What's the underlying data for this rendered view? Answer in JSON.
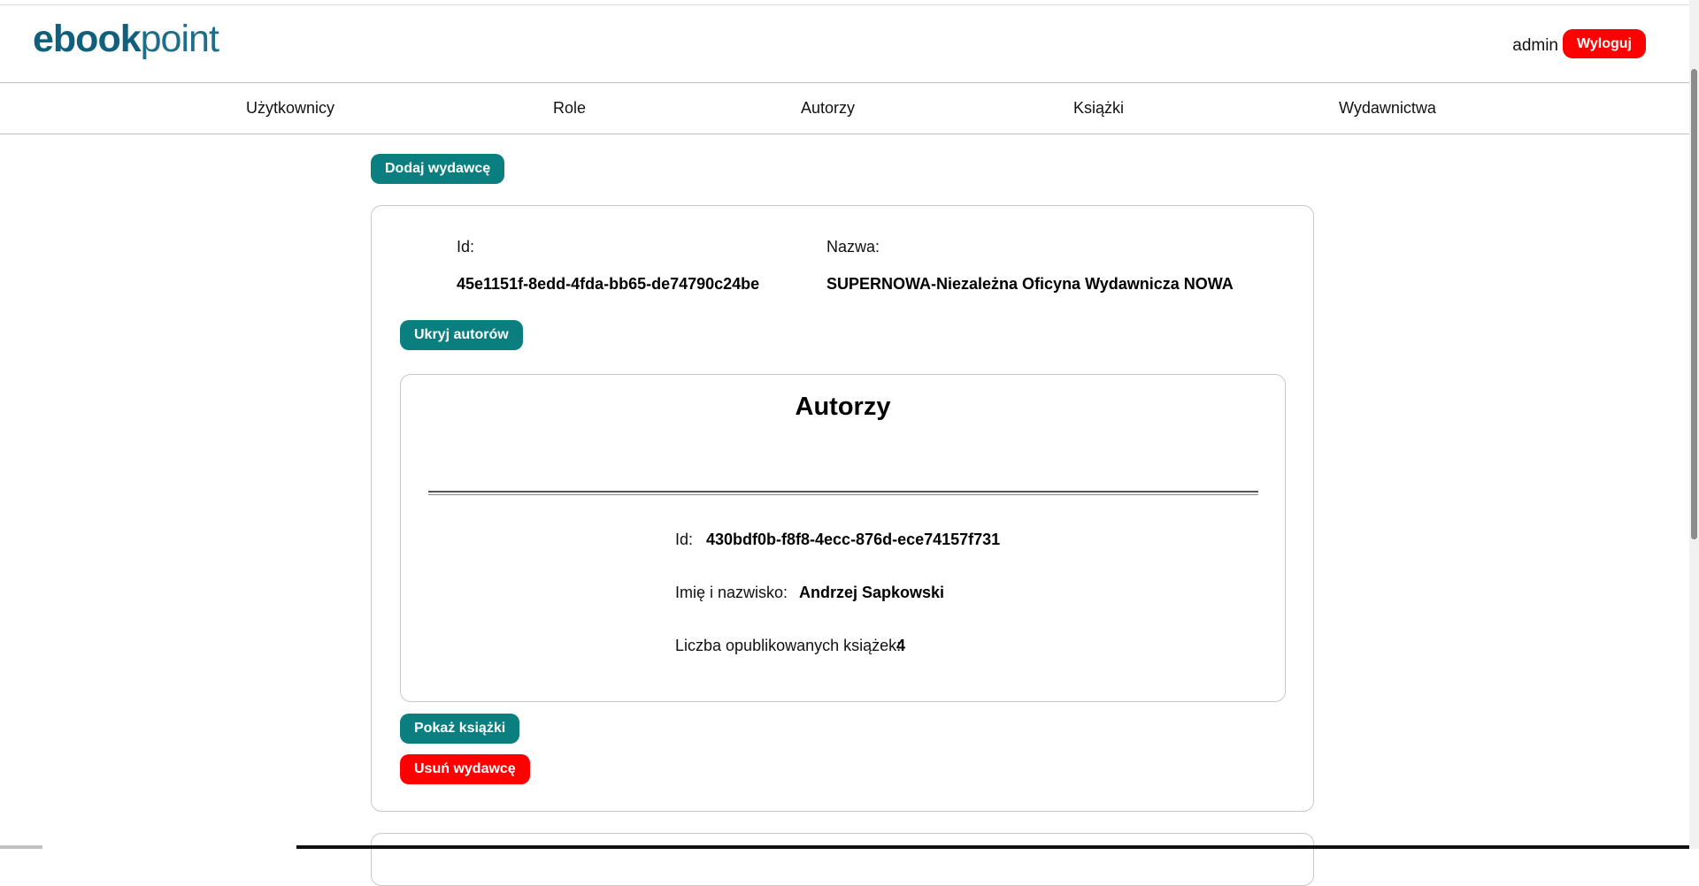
{
  "header": {
    "logo_prefix": "ebook",
    "logo_suffix": "point",
    "username": "admin",
    "logout_label": "Wyloguj"
  },
  "nav": {
    "items": [
      "Użytkownicy",
      "Role",
      "Autorzy",
      "Książki",
      "Wydawnictwa"
    ]
  },
  "toolbar": {
    "add_publisher_label": "Dodaj wydawcę"
  },
  "publisher": {
    "id_label": "Id:",
    "id_value": "45e1151f-8edd-4fda-bb65-de74790c24be",
    "name_label": "Nazwa:",
    "name_value": "SUPERNOWA-Niezależna Oficyna Wydawnicza NOWA",
    "hide_authors_label": "Ukryj autorów",
    "show_books_label": "Pokaż książki",
    "delete_label": "Usuń wydawcę",
    "authors": {
      "title": "Autorzy",
      "items": [
        {
          "id_label": "Id:",
          "id_value": "430bdf0b-f8f8-4ecc-876d-ece74157f731",
          "name_label": "Imię i nazwisko:",
          "name_value": "Andrzej Sapkowski",
          "books_label": "Liczba opublikowanych książek:",
          "books_value": "4"
        }
      ]
    }
  },
  "colors": {
    "teal_button": "#0b7f7f",
    "red_button": "#ff0000",
    "logo": "#1f6d88"
  }
}
